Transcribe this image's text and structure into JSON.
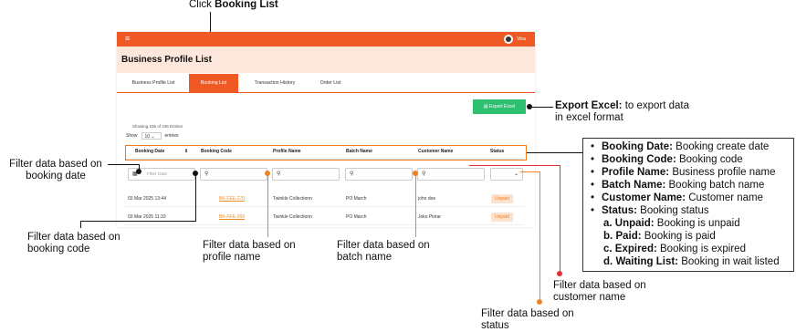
{
  "instruction": {
    "prefix": "Click ",
    "target": "Booking List"
  },
  "topbar": {
    "menu_icon": "hamburger-icon",
    "user_name": "Vina"
  },
  "page": {
    "title": "Business Profile List"
  },
  "tabs": [
    {
      "label": "Business Profile List",
      "active": false
    },
    {
      "label": "Booking List",
      "active": true
    },
    {
      "label": "Transaction History",
      "active": false
    },
    {
      "label": "Order List",
      "active": false
    }
  ],
  "export": {
    "label": "Export Excel",
    "icon": "excel-file-icon"
  },
  "entries": {
    "info": "Showing 235 of 235 Entries",
    "show_label": "Show",
    "page_size": "10",
    "entries_label": "entries"
  },
  "columns": [
    "Booking Date",
    "Booking Code",
    "Profile Name",
    "Batch Name",
    "Customer Name",
    "Status"
  ],
  "filters": {
    "date_placeholder": "Filter Date",
    "status_value": ""
  },
  "rows": [
    {
      "date": "03 Mar 2025 13:44",
      "code": "BK-FEE-270",
      "profile": "Twinkle Collectionn",
      "batch": "PO March",
      "customer": "john doe",
      "status": "Unpaid"
    },
    {
      "date": "03 Mar 2025 11:33",
      "code": "BK-FEE-269",
      "profile": "Twinkle Collectionn",
      "batch": "PO March",
      "customer": "Joko Pintar",
      "status": "Unpaid"
    }
  ],
  "annotations": {
    "export_title": "Export Excel:",
    "export_line1": " to export data",
    "export_line2": "in excel format",
    "filter_date_1": "Filter data based on",
    "filter_date_2": "booking date",
    "filter_code_1": "Filter data based on",
    "filter_code_2": "booking code",
    "filter_profile_1": "Filter data based on",
    "filter_profile_2": "profile name",
    "filter_batch_1": "Filter data based on",
    "filter_batch_2": "batch name",
    "filter_customer_1": "Filter data based on",
    "filter_customer_2": "customer name",
    "filter_status_1": "Filter data based on",
    "filter_status_2": "status"
  },
  "legend": [
    {
      "bullet": "•",
      "term": "Booking Date:",
      "desc": " Booking create date"
    },
    {
      "bullet": "•",
      "term": "Booking Code:",
      "desc": " Booking code"
    },
    {
      "bullet": "•",
      "term": "Profile Name:",
      "desc": " Business profile name"
    },
    {
      "bullet": "•",
      "term": "Batch Name:",
      "desc": " Booking batch name"
    },
    {
      "bullet": "•",
      "term": "Customer Name:",
      "desc": " Customer name"
    },
    {
      "bullet": "•",
      "term": "Status:",
      "desc": " Booking status"
    },
    {
      "bullet": "a.",
      "term": "Unpaid:",
      "desc": " Booking is unpaid"
    },
    {
      "bullet": "b.",
      "term": "Paid:",
      "desc": " Booking is paid"
    },
    {
      "bullet": "c.",
      "term": "Expired:",
      "desc": " Booking is expired"
    },
    {
      "bullet": "d.",
      "term": "Waiting List:",
      "desc": " Booking in wait listed"
    }
  ],
  "colors": {
    "accent": "#ef5a24",
    "header_band": "#fde7dc",
    "export_button": "#2fbf71",
    "status_badge": "#fde3cf",
    "link": "#ef8a1f"
  }
}
